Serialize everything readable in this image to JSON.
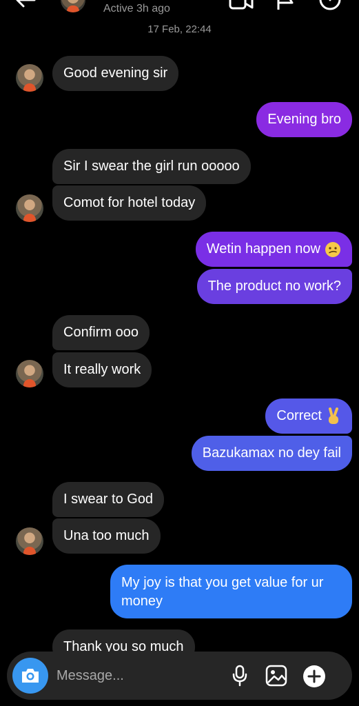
{
  "header": {
    "status": "Active 3h ago"
  },
  "conversation": {
    "date": "17 Feb, 22:44",
    "messages": [
      {
        "from": "them",
        "text": "Good evening sir"
      },
      {
        "from": "me",
        "text": "Evening bro"
      },
      {
        "from": "them",
        "text": "Sir I swear the girl run ooooo"
      },
      {
        "from": "them",
        "text": "Comot for hotel today"
      },
      {
        "from": "me",
        "text": "Wetin happen now",
        "emoji": "confused-face"
      },
      {
        "from": "me",
        "text": "The product no work?"
      },
      {
        "from": "them",
        "text": "Confirm ooo"
      },
      {
        "from": "them",
        "text": "It really work"
      },
      {
        "from": "me",
        "text": "Correct",
        "emoji": "victory-hand"
      },
      {
        "from": "me",
        "text": "Bazukamax no dey fail"
      },
      {
        "from": "them",
        "text": "I swear to God"
      },
      {
        "from": "them",
        "text": "Una too much"
      },
      {
        "from": "me",
        "text": "My joy is that you get value for ur money"
      },
      {
        "from": "them",
        "text": "Thank you so much"
      }
    ]
  },
  "composer": {
    "placeholder": "Message..."
  },
  "colors": {
    "incoming": "#262626",
    "outgoing_purple": "#8a2be2",
    "outgoing_violet": "#6a3fe0",
    "outgoing_indigo": "#4f5fe8",
    "outgoing_blue": "#2e7cf6",
    "camera": "#3897f0"
  }
}
